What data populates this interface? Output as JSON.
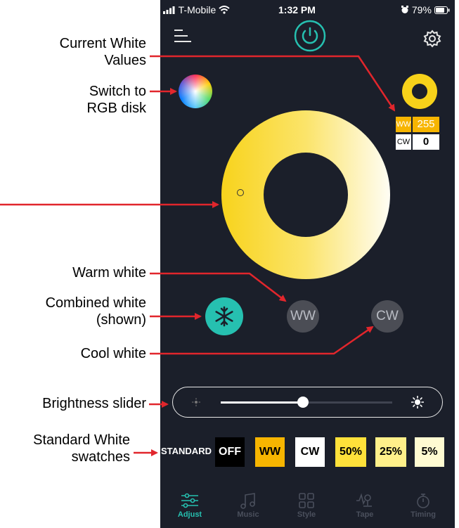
{
  "status_bar": {
    "carrier": "T-Mobile",
    "time": "1:32 PM",
    "battery": "79%"
  },
  "current_values": {
    "ww_label": "WW",
    "ww_value": "255",
    "cw_label": "CW",
    "cw_value": "0"
  },
  "modes": {
    "ww_label": "WW",
    "cw_label": "CW"
  },
  "swatches": {
    "label": "STANDARD",
    "items": [
      {
        "label": "OFF",
        "bg": "#000000",
        "fg": "#ffffff"
      },
      {
        "label": "WW",
        "bg": "#f7b500",
        "fg": "#000000"
      },
      {
        "label": "CW",
        "bg": "#ffffff",
        "fg": "#000000"
      },
      {
        "label": "50%",
        "bg": "#ffe13a",
        "fg": "#000000"
      },
      {
        "label": "25%",
        "bg": "#fff08a",
        "fg": "#000000"
      },
      {
        "label": "5%",
        "bg": "#fffbd2",
        "fg": "#000000"
      }
    ]
  },
  "brightness": {
    "level_fraction": 0.48
  },
  "tabs": [
    {
      "label": "Adjust",
      "icon": "sliders-icon",
      "active": true
    },
    {
      "label": "Music",
      "icon": "music-note-icon",
      "active": false
    },
    {
      "label": "Style",
      "icon": "grid-icon",
      "active": false
    },
    {
      "label": "Tape",
      "icon": "tape-icon",
      "active": false
    },
    {
      "label": "Timing",
      "icon": "stopwatch-icon",
      "active": false
    }
  ],
  "annotations": {
    "current_values": "Current White\nValues",
    "switch_rgb": "Switch to\nRGB disk",
    "warm_white": "Warm white",
    "combined_white": "Combined white\n(shown)",
    "cool_white": "Cool white",
    "brightness_slider": "Brightness slider",
    "standard_swatches": "Standard White\nswatches"
  },
  "colors": {
    "accent": "#26c0b0",
    "warm": "#f7d21a",
    "annotation": "#e1262c",
    "background": "#1b1f2a"
  }
}
